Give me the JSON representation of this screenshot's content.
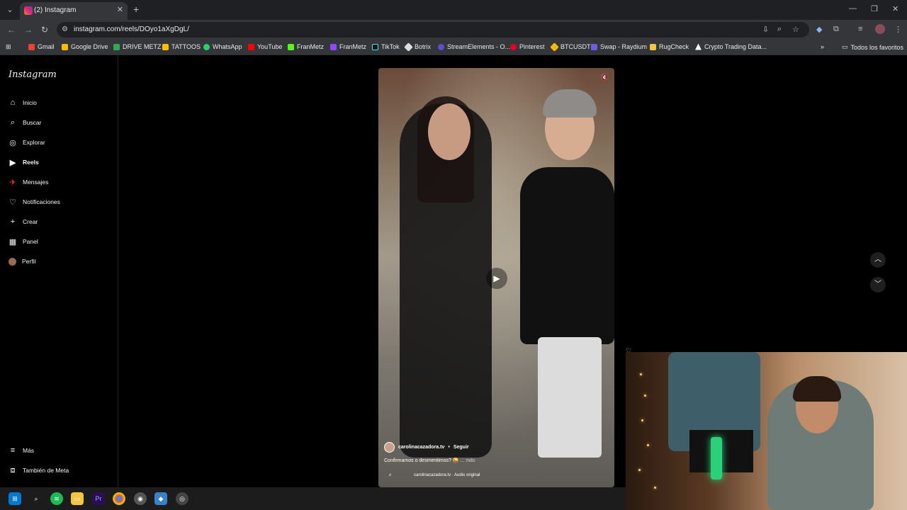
{
  "browser": {
    "tab_title": "(2) Instagram",
    "url": "instagram.com/reels/DOyo1aXgDgL/",
    "bookmarks": [
      "Gmail",
      "Google Drive",
      "DRIVE METZ",
      "TATTOOS",
      "WhatsApp",
      "YouTube",
      "FranMetz",
      "FranMetz",
      "TikTok",
      "Botrix",
      "StreamElements - O...",
      "Pinterest",
      "BTCUSDT",
      "Swap - Raydium",
      "RugCheck",
      "Crypto Trading Data..."
    ],
    "all_bookmarks": "Todos los favoritos"
  },
  "instagram": {
    "logo": "Instagram",
    "nav": [
      "Inicio",
      "Buscar",
      "Explorar",
      "Reels",
      "Mensajes",
      "Notificaciones",
      "Crear",
      "Panel",
      "Perfil"
    ],
    "more": "Más",
    "meta": "También de Meta"
  },
  "reel": {
    "username": "carolinacazadora.tv",
    "follow": "Seguir",
    "caption": "Confirmamos o desmentimos? 😜",
    "more": "... más",
    "audio": "carolinacazadora.tv · Audio original"
  }
}
